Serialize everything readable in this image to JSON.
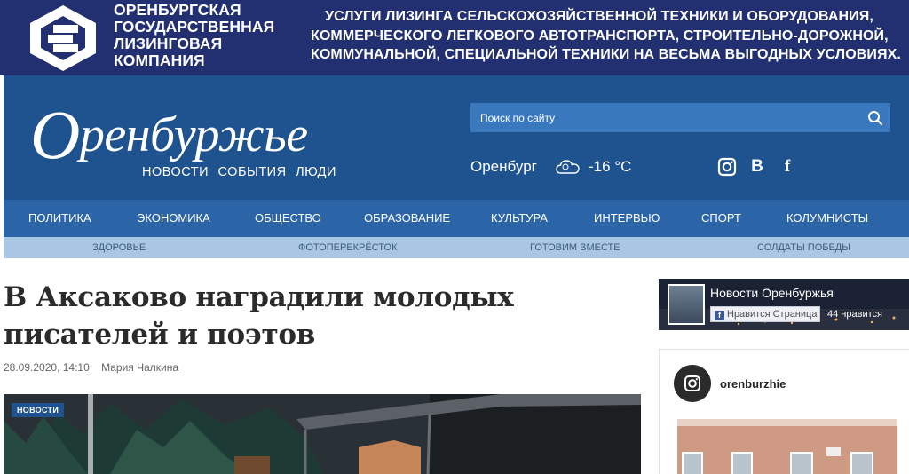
{
  "ad": {
    "company_lines": [
      "ОРЕНБУРГСКАЯ",
      "ГОСУДАРСТВЕННАЯ",
      "ЛИЗИНГОВАЯ",
      "КОМПАНИЯ"
    ],
    "text_lines": [
      "УСЛУГИ ЛИЗИНГА СЕЛЬСКОХОЗЯЙСТВЕННОЙ ТЕХНИКИ И ОБОРУДОВАНИЯ,",
      "КОММЕРЧЕСКОГО ЛЕГКОВОГО АВТОТРАНСПОРТА, СТРОИТЕЛЬНО-ДОРОЖНОЙ,",
      "КОММУНАЛЬНОЙ, СПЕЦИАЛЬНОЙ ТЕХНИКИ НА ВЕСЬМА ВЫГОДНЫХ УСЛОВИЯХ."
    ]
  },
  "header": {
    "logo_first": "О",
    "logo_rest": "ренбуржье",
    "tagline": [
      "НОВОСТИ",
      "СОБЫТИЯ",
      "ЛЮДИ"
    ],
    "search_placeholder": "Поиск по сайту",
    "weather": {
      "city": "Оренбург",
      "temp": "-16 °C"
    },
    "social": {
      "vk_label": "B",
      "fb_label": "f"
    }
  },
  "nav": {
    "primary": [
      "ПОЛИТИКА",
      "ЭКОНОМИКА",
      "ОБЩЕСТВО",
      "ОБРАЗОВАНИЕ",
      "КУЛЬТУРА",
      "ИНТЕРВЬЮ",
      "СПОРТ",
      "КОЛУМНИСТЫ"
    ],
    "secondary": [
      "ЗДОРОВЬЕ",
      "ФОТОПЕРЕКРЁСТОК",
      "ГОТОВИМ ВМЕСТЕ",
      "СОЛДАТЫ ПОБЕДЫ"
    ]
  },
  "article": {
    "title_line1": "В Аксаково наградили молодых",
    "title_line2": "писателей и поэтов",
    "date": "28.09.2020, 14:10",
    "author": "Мария Чалкина",
    "badge": "НОВОСТИ"
  },
  "sidebar": {
    "fb_page_name": "Новости Оренбуржья",
    "fb_like_label": "Нравится Страница",
    "fb_like_count": "44 нравится",
    "insta_handle": "orenburzhie"
  },
  "colors": {
    "ad_bg": "#223072",
    "header_bg": "#1f5390",
    "nav_bg": "#2b65a7",
    "subnav_bg": "#a9c6e3"
  }
}
